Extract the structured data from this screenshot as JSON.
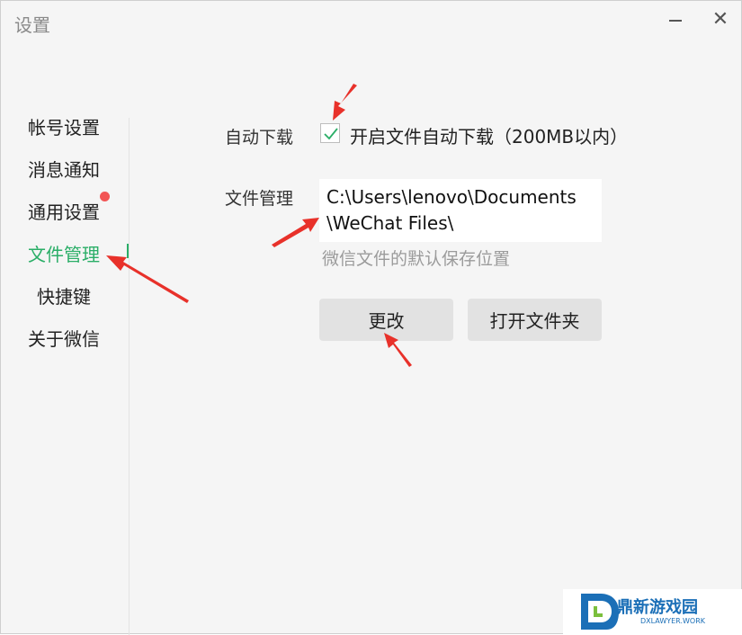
{
  "window": {
    "title": "设置",
    "minimize_icon": "minimize-icon",
    "close_icon": "close-icon",
    "close_glyph": "✕"
  },
  "sidebar": {
    "items": [
      {
        "label": "帐号设置"
      },
      {
        "label": "消息通知"
      },
      {
        "label": "通用设置",
        "has_badge": true
      },
      {
        "label": "文件管理",
        "active": true
      },
      {
        "label": "快捷键"
      },
      {
        "label": "关于微信"
      }
    ]
  },
  "settings": {
    "auto_download": {
      "label": "自动下载",
      "checkbox_text": "开启文件自动下载（200MB以内）",
      "checked": true
    },
    "file_management": {
      "label": "文件管理",
      "path": "C:\\Users\\lenovo\\Documents\\WeChat Files\\",
      "hint": "微信文件的默认保存位置"
    },
    "buttons": {
      "change": "更改",
      "open_folder": "打开文件夹"
    }
  },
  "watermark": {
    "logo_text": "鼎新游戏园",
    "sub_text": "DXLAWYER.WORK"
  },
  "colors": {
    "accent": "#2aae67",
    "badge": "#f25555",
    "annotation_arrow": "#e8312a",
    "watermark": "#1b6fb7"
  }
}
